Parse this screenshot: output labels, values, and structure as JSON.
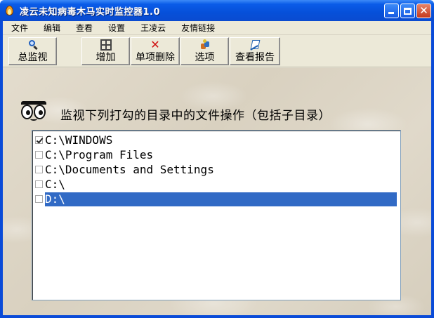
{
  "window": {
    "title": "凌云未知病毒木马实时监控器1.0"
  },
  "menubar": {
    "items": [
      "文件",
      "编辑",
      "查看",
      "设置",
      "王凌云",
      "友情链接"
    ]
  },
  "toolbar": {
    "buttons": [
      {
        "label": "总监视",
        "icon": "magnifier-icon"
      },
      {
        "label": "增加",
        "icon": "grid-icon"
      },
      {
        "label": "单项删除",
        "icon": "delete-x-icon"
      },
      {
        "label": "选项",
        "icon": "options-icon"
      },
      {
        "label": "查看报告",
        "icon": "report-icon"
      }
    ]
  },
  "main": {
    "caption": "监视下列打勾的目录中的文件操作（包括子目录）",
    "directories": [
      {
        "path": "C:\\WINDOWS",
        "checked": true,
        "selected": false
      },
      {
        "path": "C:\\Program Files",
        "checked": false,
        "selected": false
      },
      {
        "path": "C:\\Documents and Settings",
        "checked": false,
        "selected": false
      },
      {
        "path": "C:\\",
        "checked": false,
        "selected": false
      },
      {
        "path": "D:\\",
        "checked": false,
        "selected": true
      }
    ]
  },
  "colors": {
    "titlebar": "#0a5ce8",
    "selection": "#316ac5",
    "face": "#ece9d8"
  }
}
